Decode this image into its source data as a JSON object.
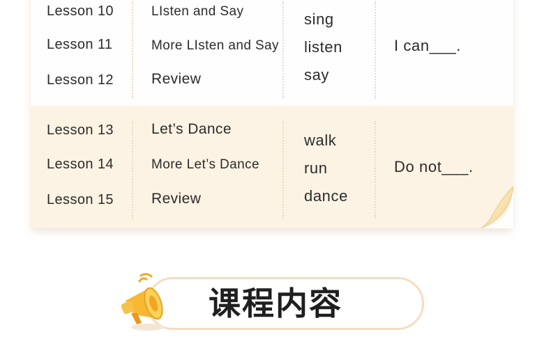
{
  "schedule": {
    "group_a": {
      "rows": [
        {
          "lesson": "Lesson 10",
          "title": "LIsten and Say"
        },
        {
          "lesson": "Lesson 11",
          "title": "More LIsten and Say"
        },
        {
          "lesson": "Lesson 12",
          "title": "Review"
        }
      ],
      "words": [
        "sing",
        "listen",
        "say"
      ],
      "sentence": "I can___."
    },
    "group_b": {
      "rows": [
        {
          "lesson": "Lesson 13",
          "title": "Let’s Dance"
        },
        {
          "lesson": "Lesson 14",
          "title": "More Let’s Dance"
        },
        {
          "lesson": "Lesson 15",
          "title": "Review"
        }
      ],
      "words": [
        "walk",
        "run",
        "dance"
      ],
      "sentence": "Do not___."
    }
  },
  "section": {
    "title": "课程内容",
    "icon": "megaphone-icon"
  },
  "colors": {
    "cream_band": "#fdf3e4",
    "accent_orange": "#f5a623",
    "banner_border": "#f7dcc0"
  }
}
